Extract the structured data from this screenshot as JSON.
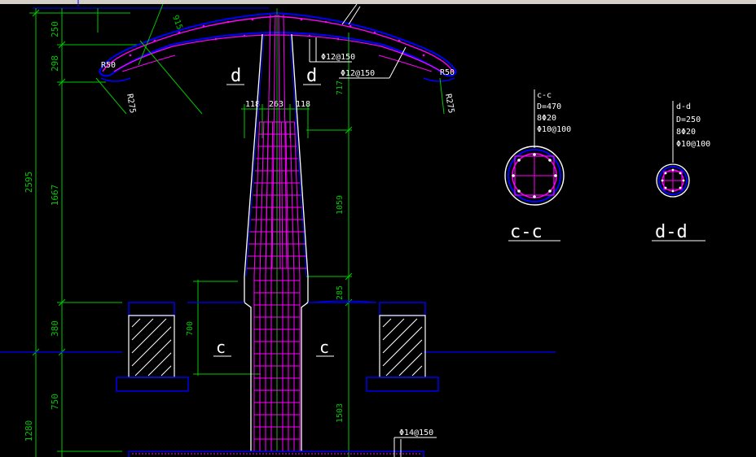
{
  "colors": {
    "background": "#000000",
    "dim": "#00c800",
    "structure": "#ffffff",
    "rebar": "#ff00ff",
    "outline": "#0000ff",
    "topbar": "#d4d0c8"
  },
  "dims_left": [
    "250",
    "298",
    "2595",
    "1667",
    "380",
    "750",
    "1280"
  ],
  "dims_center": [
    "118",
    "263",
    "118",
    "717",
    "1059",
    "285",
    "1503",
    "700"
  ],
  "radii": [
    "R50",
    "R275",
    "R50",
    "R275"
  ],
  "slope_dim": "915",
  "rebar_callouts": [
    "Φ12@150",
    "Φ12@150",
    "Φ14@150"
  ],
  "section_marks": {
    "d_left": "d",
    "d_right": "d",
    "c_left": "c",
    "c_right": "c"
  },
  "section_cc": {
    "title": "c-c",
    "lines": [
      "c-c",
      "D=470",
      "8Φ20",
      "Φ10@100"
    ]
  },
  "section_dd": {
    "title": "d-d",
    "lines": [
      "d-d",
      "D=250",
      "8Φ20",
      "Φ10@100"
    ]
  }
}
